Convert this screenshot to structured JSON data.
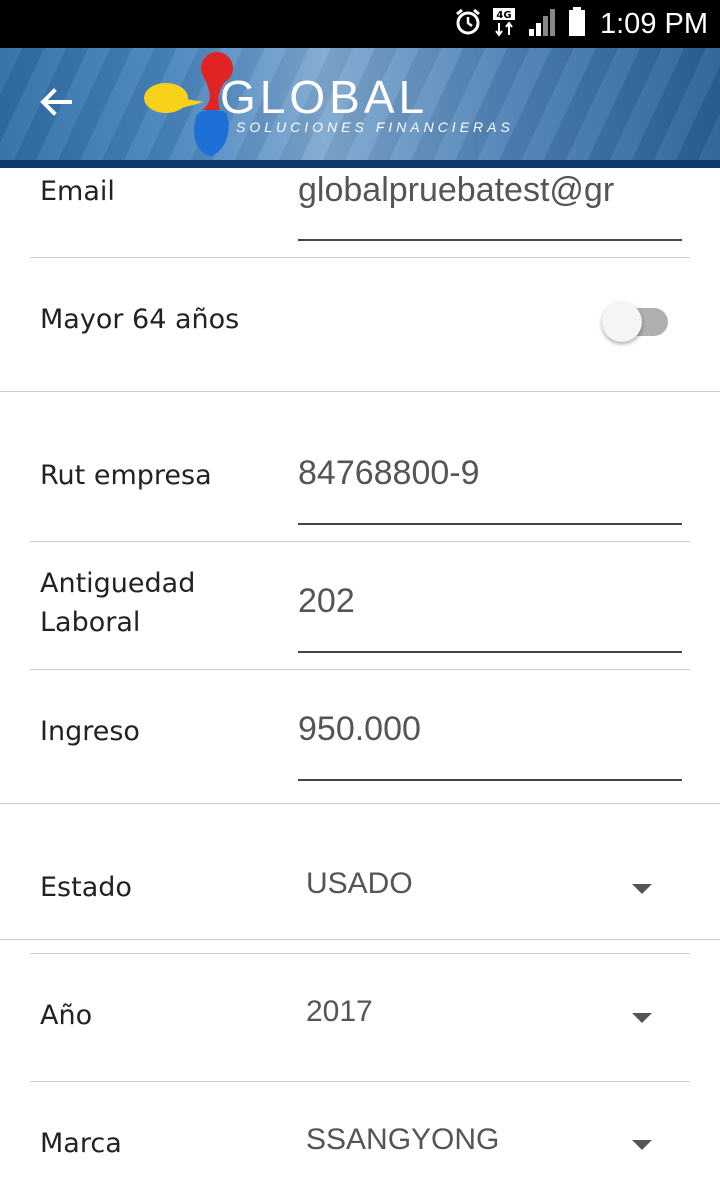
{
  "status_bar": {
    "time": "1:09 PM",
    "network": "4G"
  },
  "header": {
    "brand": "GLOBAL",
    "tagline": "SOLUCIONES FINANCIERAS"
  },
  "form": {
    "email": {
      "label": "Email",
      "value": "globalpruebatest@gr"
    },
    "mayor64": {
      "label": "Mayor 64 años",
      "checked": false
    },
    "rut_empresa": {
      "label": "Rut empresa",
      "value": "84768800-9"
    },
    "antiguedad": {
      "label_line1": "Antiguedad",
      "label_line2": "Laboral",
      "value": "202"
    },
    "ingreso": {
      "label": "Ingreso",
      "value": "950.000"
    },
    "estado": {
      "label": "Estado",
      "value": "USADO"
    },
    "anio": {
      "label": "Año",
      "value": "2017"
    },
    "marca": {
      "label": "Marca",
      "value": "SSANGYONG"
    }
  },
  "colors": {
    "header_blue": "#2f6da6",
    "header_strip": "#0d3a6b",
    "logo_red": "#e02424",
    "logo_yellow": "#f6d21a",
    "logo_blue": "#1e6fd6"
  }
}
